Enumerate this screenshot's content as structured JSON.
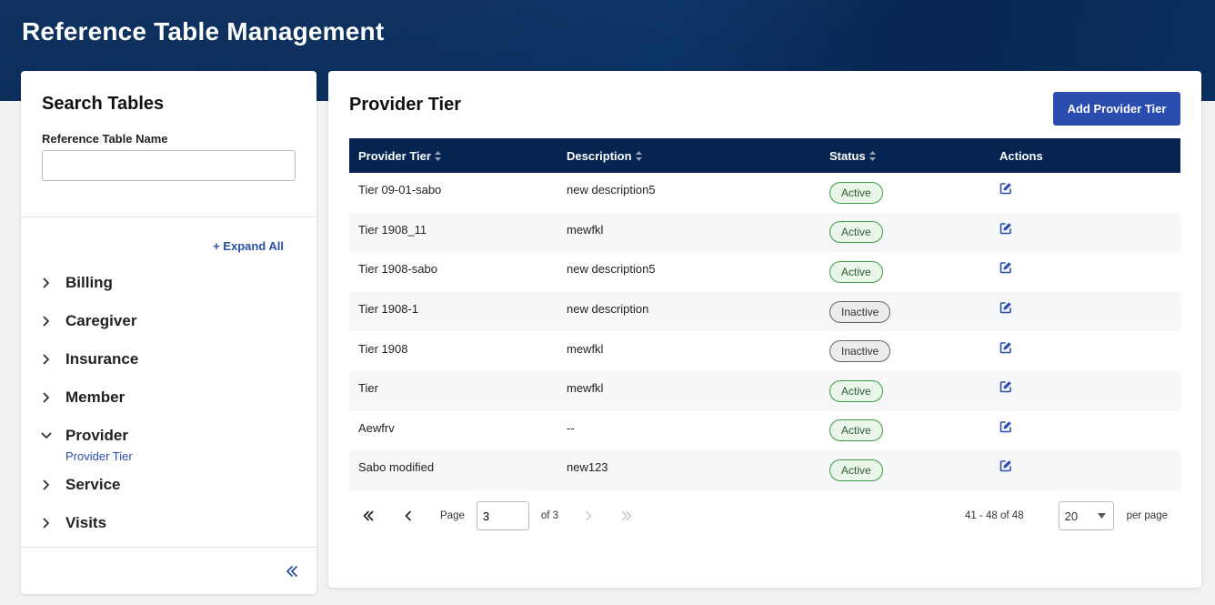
{
  "app": {
    "title": "Reference Table Management"
  },
  "sidebar": {
    "title": "Search Tables",
    "field_label": "Reference Table Name",
    "search_value": "",
    "expand_all": "+ Expand All",
    "items": [
      {
        "label": "Billing",
        "expanded": false
      },
      {
        "label": "Caregiver",
        "expanded": false
      },
      {
        "label": "Insurance",
        "expanded": false
      },
      {
        "label": "Member",
        "expanded": false
      },
      {
        "label": "Provider",
        "expanded": true,
        "children": [
          "Provider Tier"
        ]
      },
      {
        "label": "Service",
        "expanded": false
      },
      {
        "label": "Visits",
        "expanded": false
      }
    ],
    "collapse_icon": "double-chevron-left-icon"
  },
  "main": {
    "title": "Provider Tier",
    "add_button": "Add Provider Tier",
    "columns": [
      "Provider Tier",
      "Description",
      "Status",
      "Actions"
    ],
    "rows": [
      {
        "tier": "Tier 09-01-sabo",
        "description": "new description5",
        "status": "Active"
      },
      {
        "tier": "Tier 1908_11",
        "description": "mewfkl",
        "status": "Active"
      },
      {
        "tier": "Tier 1908-sabo",
        "description": "new description5",
        "status": "Active"
      },
      {
        "tier": "Tier 1908-1",
        "description": "new description",
        "status": "Inactive"
      },
      {
        "tier": "Tier 1908",
        "description": "mewfkl",
        "status": "Inactive"
      },
      {
        "tier": "Tier",
        "description": "mewfkl",
        "status": "Active"
      },
      {
        "tier": "Aewfrv",
        "description": "--",
        "status": "Active"
      },
      {
        "tier": "Sabo modified",
        "description": "new123",
        "status": "Active"
      }
    ],
    "pagination": {
      "page_label": "Page",
      "page_value": "3",
      "of_label": "of 3",
      "range": "41 - 48 of 48",
      "per_page_value": "20",
      "per_page_label": "per page"
    }
  },
  "colors": {
    "header": "#062a5a",
    "table_header": "#052451",
    "accent": "#2b4db0",
    "link": "#2a4fa8",
    "active_border": "#3e9a4a",
    "active_bg": "#eaf6ea"
  }
}
